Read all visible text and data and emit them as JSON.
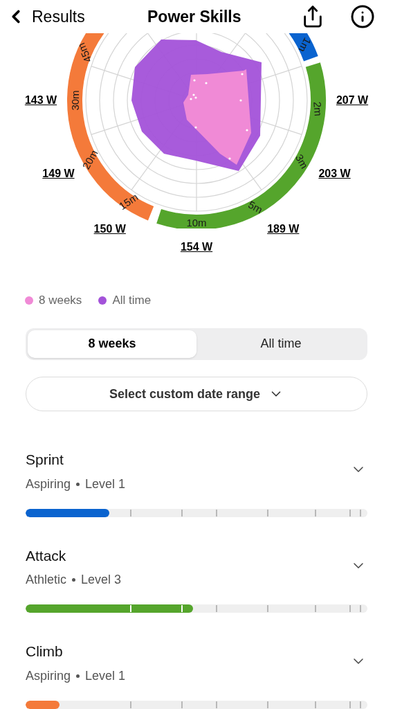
{
  "header": {
    "back_label": "Results",
    "title": "Power Skills"
  },
  "chart": {
    "ring_segments": [
      {
        "color": "#f47a3a"
      },
      {
        "color": "#55a52c"
      },
      {
        "color": "#0a63cf"
      }
    ],
    "duration_labels": [
      "45m",
      "1m",
      "30m",
      "2m",
      "20m",
      "3m",
      "15m",
      "5m",
      "10m"
    ],
    "watt_labels": [
      "143 W",
      "207 W",
      "149 W",
      "203 W",
      "150 W",
      "189 W",
      "154 W"
    ]
  },
  "legend": [
    {
      "label": "8 weeks",
      "color": "#f08ad6"
    },
    {
      "label": "All time",
      "color": "#a352d9"
    }
  ],
  "tabs": [
    {
      "label": "8 weeks",
      "selected": true
    },
    {
      "label": "All time",
      "selected": false
    }
  ],
  "date_range_button": "Select custom date range",
  "skills": [
    {
      "name": "Sprint",
      "tier": "Aspiring",
      "level_label": "Level 1",
      "level": 0.245,
      "color": "#0a63cf"
    },
    {
      "name": "Attack",
      "tier": "Athletic",
      "level_label": "Level 3",
      "level": 0.49,
      "color": "#55a52c"
    },
    {
      "name": "Climb",
      "tier": "Aspiring",
      "level_label": "Level 1",
      "level": 0.1,
      "color": "#f47a3a"
    }
  ]
}
